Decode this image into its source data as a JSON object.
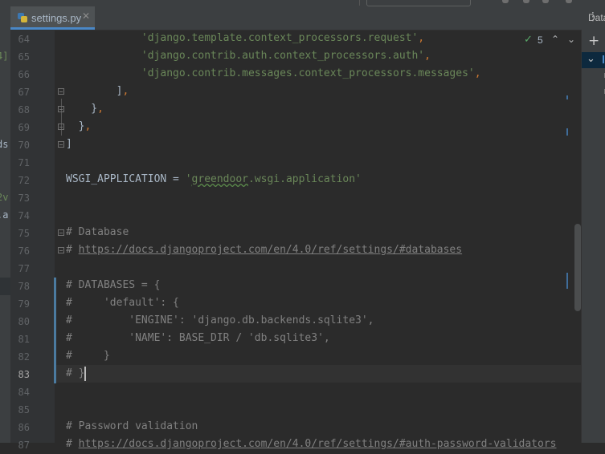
{
  "tab": {
    "filename": "settings.py",
    "close": "✕"
  },
  "menu_icon": "⋮",
  "right_panel": {
    "title": "Datab",
    "add": "+",
    "expand": "⌄"
  },
  "left_fragments": [
    "4]",
    "ds",
    "2v",
    ".a"
  ],
  "inspection": {
    "count": "5",
    "up": "⌃",
    "down": "⌄"
  },
  "line_numbers": [
    "64",
    "65",
    "66",
    "67",
    "68",
    "69",
    "70",
    "71",
    "72",
    "73",
    "74",
    "75",
    "76",
    "77",
    "78",
    "79",
    "80",
    "81",
    "82",
    "83",
    "84",
    "85",
    "86",
    "87"
  ],
  "current_line": "83",
  "code": [
    [
      {
        "t": "            ",
        "k": ""
      },
      {
        "t": "'django.template.context_processors.request'",
        "k": "s"
      },
      {
        "t": ",",
        "k": "p"
      }
    ],
    [
      {
        "t": "            ",
        "k": ""
      },
      {
        "t": "'django.contrib.auth.context_processors.auth'",
        "k": "s"
      },
      {
        "t": ",",
        "k": "p"
      }
    ],
    [
      {
        "t": "            ",
        "k": ""
      },
      {
        "t": "'django.contrib.messages.context_processors.messages'",
        "k": "s"
      },
      {
        "t": ",",
        "k": "p"
      }
    ],
    [
      {
        "t": "        ]",
        "k": ""
      },
      {
        "t": ",",
        "k": "p"
      }
    ],
    [
      {
        "t": "    }",
        "k": ""
      },
      {
        "t": ",",
        "k": "p"
      }
    ],
    [
      {
        "t": "  }",
        "k": ""
      },
      {
        "t": ",",
        "k": "p"
      }
    ],
    [
      {
        "t": "]",
        "k": ""
      }
    ],
    [],
    [
      {
        "t": "WSGI_APPLICATION = ",
        "k": ""
      },
      {
        "t": "'",
        "k": "s"
      },
      {
        "t": "greendoor",
        "k": "w"
      },
      {
        "t": ".wsgi.application'",
        "k": "s"
      }
    ],
    [],
    [],
    [
      {
        "t": "# Database",
        "k": "c"
      }
    ],
    [
      {
        "t": "# ",
        "k": "c"
      },
      {
        "t": "https://docs.djangoproject.com/en/4.0/ref/settings/#databases",
        "k": "u"
      }
    ],
    [],
    [
      {
        "t": "# DATABASES = {",
        "k": "c"
      }
    ],
    [
      {
        "t": "#     'default': {",
        "k": "c"
      }
    ],
    [
      {
        "t": "#         'ENGINE': 'django.db.backends.sqlite3',",
        "k": "c"
      }
    ],
    [
      {
        "t": "#         'NAME': BASE_DIR / 'db.sqlite3',",
        "k": "c"
      }
    ],
    [
      {
        "t": "#     }",
        "k": "c"
      }
    ],
    [
      {
        "t": "# }",
        "k": "c"
      }
    ],
    [],
    [],
    [
      {
        "t": "# Password validation",
        "k": "c"
      }
    ],
    [
      {
        "t": "# ",
        "k": "c"
      },
      {
        "t": "https://docs.djangoproject.com/en/4.0/ref/settings/#auth-password-validators",
        "k": "u"
      }
    ]
  ]
}
